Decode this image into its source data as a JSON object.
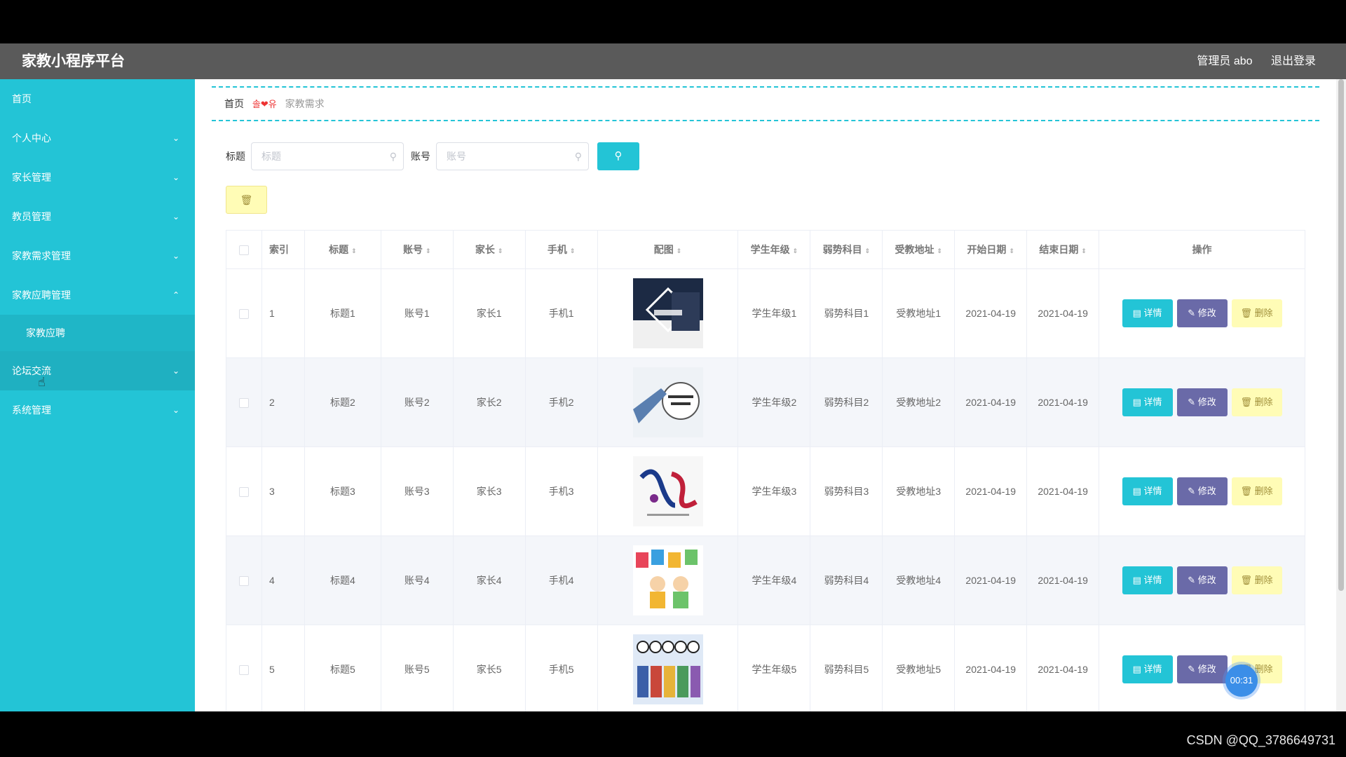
{
  "app": {
    "title": "家教小程序平台"
  },
  "header": {
    "admin_label": "管理员 abo",
    "logout_label": "退出登录"
  },
  "sidebar": {
    "items": [
      {
        "label": "首页",
        "chevron": ""
      },
      {
        "label": "个人中心",
        "chevron": "⌄"
      },
      {
        "label": "家长管理",
        "chevron": "⌄"
      },
      {
        "label": "教员管理",
        "chevron": "⌄"
      },
      {
        "label": "家教需求管理",
        "chevron": "⌄"
      },
      {
        "label": "家教应聘管理",
        "chevron": "⌃"
      },
      {
        "label": "家教应聘",
        "chevron": ""
      },
      {
        "label": "论坛交流",
        "chevron": "⌄"
      },
      {
        "label": "系统管理",
        "chevron": "⌄"
      }
    ]
  },
  "breadcrumb": {
    "home": "首页",
    "separator": "솔❤유",
    "current": "家教需求"
  },
  "search": {
    "title_label": "标题",
    "title_placeholder": "标题",
    "account_label": "账号",
    "account_placeholder": "账号",
    "search_icon": "search-icon"
  },
  "toolbar": {
    "delete_icon": "🗑"
  },
  "table": {
    "headers": [
      "索引",
      "标题",
      "账号",
      "家长",
      "手机",
      "配图",
      "学生年级",
      "弱势科目",
      "受教地址",
      "开始日期",
      "结束日期",
      "操作"
    ],
    "rows": [
      {
        "index": "1",
        "title": "标题1",
        "account": "账号1",
        "parent": "家长1",
        "phone": "手机1",
        "image": "business-poster",
        "grade": "学生年级1",
        "weak": "弱势科目1",
        "address": "受教地址1",
        "start": "2021-04-19",
        "end": "2021-04-19"
      },
      {
        "index": "2",
        "title": "标题2",
        "account": "账号2",
        "parent": "家长2",
        "phone": "手机2",
        "image": "business-training",
        "grade": "学生年级2",
        "weak": "弱势科目2",
        "address": "受教地址2",
        "start": "2021-04-19",
        "end": "2021-04-19"
      },
      {
        "index": "3",
        "title": "标题3",
        "account": "账号3",
        "parent": "家长3",
        "phone": "手机3",
        "image": "calligraphy",
        "grade": "学生年级3",
        "weak": "弱势科目3",
        "address": "受教地址3",
        "start": "2021-04-19",
        "end": "2021-04-19"
      },
      {
        "index": "4",
        "title": "标题4",
        "account": "账号4",
        "parent": "家长4",
        "phone": "手机4",
        "image": "abcd-kids",
        "grade": "学生年级4",
        "weak": "弱势科目4",
        "address": "受教地址4",
        "start": "2021-04-19",
        "end": "2021-04-19"
      },
      {
        "index": "5",
        "title": "标题5",
        "account": "账号5",
        "parent": "家长5",
        "phone": "手机5",
        "image": "hello-kids",
        "grade": "学生年级5",
        "weak": "弱势科目5",
        "address": "受教地址5",
        "start": "2021-04-19",
        "end": "2021-04-19"
      }
    ],
    "actions": {
      "detail": "▤ 详情",
      "edit": "✎ 修改",
      "delete": "🗑 删除"
    }
  },
  "overlay": {
    "timer": "00:31",
    "watermark": "CSDN @QQ_3786649731"
  },
  "colors": {
    "accent": "#23c4d6",
    "header": "#5a5a5a",
    "edit": "#6a6aa8",
    "delete_bg": "#fffcb6"
  }
}
